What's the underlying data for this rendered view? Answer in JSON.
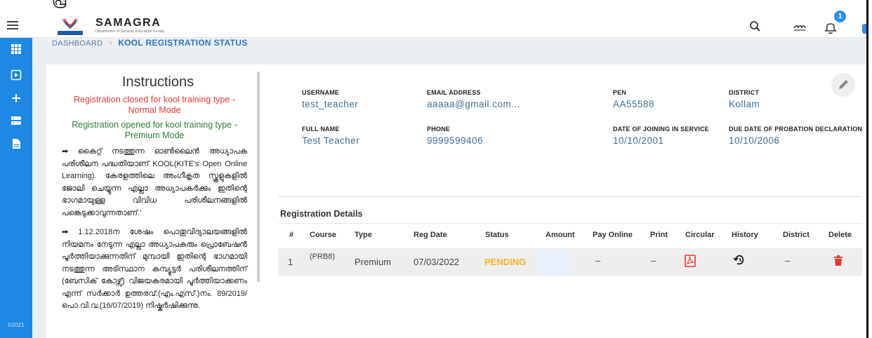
{
  "header": {
    "menu_icon": "hamburger-icon",
    "brand": "SAMAGRA",
    "brand_subtitle": "Department of General Education Kerala",
    "logo_text": "SAMAGRA",
    "notification_count": "1",
    "icons": [
      "search-icon",
      "language-icon",
      "bell-icon"
    ]
  },
  "top_fragment": "പ്ര",
  "sidebar": {
    "icons": [
      "apps-grid-icon",
      "play-box-icon",
      "plus-icon",
      "list-card-icon",
      "document-icon"
    ],
    "footer": "©2021"
  },
  "breadcrumb": {
    "home": "DASHBOARD",
    "current": "KOOL REGISTRATION STATUS"
  },
  "instructions": {
    "title": "Instructions",
    "closed_notice": "Registration closed for kool training type - Normal Mode",
    "open_notice": "Registration opened for kool training type - Premium Mode",
    "para1": "➡ കൈറ്റ് നടത്തുന്ന ഓൺലൈൻ അധ്യാപക പരിശീലന പദ്ധതിയാണ് KOOL(KITE's Open Online Learning). കേരളത്തിലെ അംഗീകൃത സ്കൂളുകളിൽ ജോലി ചെയ്യുന്ന എല്ലാ അധ്യാപകർക്കും ഇതിന്റെ ഭാഗമായുള്ള വിവിധ പരിശീലനങ്ങളിൽ പങ്കെടുക്കാവുന്നതാണ്.'",
    "para2": "➡ 1.12.2018ന ശേഷം പൊതുവിദ്യാലയങ്ങളിൽ നിയമനം നേടുന്ന എല്ലാ അധ്യാപകരും പ്രൊബേഷൻ പൂർത്തിയാക്കുന്നതിന് മുമ്പായി ഇതിന്റെ ഭാഗമായി നടത്തുന്ന അടിസ്ഥാന കമ്പ്യൂട്ടർ പരിശീലനത്തിന് (ബേസിക് കോഴ്സ്) വിജയകരമായി പൂർത്തിയാക്കണം എന്ന് സർക്കാർ ഉത്തരവ്:(എം.എസ്.)നം. 89/2019/ പൊ.വി.വ.(16/07/2019) നിഷ്കർഷിക്കുന്നു."
  },
  "profile": {
    "username_label": "USERNAME",
    "username": "test_teacher",
    "email_label": "EMAIL ADDRESS",
    "email": "aaaaa@gmail.com...",
    "pen_label": "PEN",
    "pen": "AA55588",
    "district_label": "DISTRICT",
    "district": "Kollam",
    "fullname_label": "FULL NAME",
    "fullname": "Test Teacher",
    "phone_label": "PHONE",
    "phone": "9999599406",
    "doj_label": "DATE OF JOINING IN SERVICE",
    "doj": "10/10/2001",
    "probation_label": "DUE DATE OF PROBATION DECLARATION",
    "probation": "10/10/2006",
    "edit_icon": "pencil-icon"
  },
  "registration": {
    "title": "Registration Details",
    "columns": [
      "#",
      "Course",
      "Type",
      "Reg Date",
      "Status",
      "Amount",
      "Pay Online",
      "Print",
      "Circular",
      "History",
      "District",
      "Delete"
    ],
    "row": {
      "index": "1",
      "course": "(PRB8)",
      "type": "Premium",
      "reg_date": "07/03/2022",
      "status": "PENDING",
      "pay_online": "–",
      "print": "–",
      "district": "–"
    },
    "status_color": "#f6b42a",
    "row_icons": [
      "pdf-icon",
      "history-icon",
      "trash-icon"
    ]
  }
}
